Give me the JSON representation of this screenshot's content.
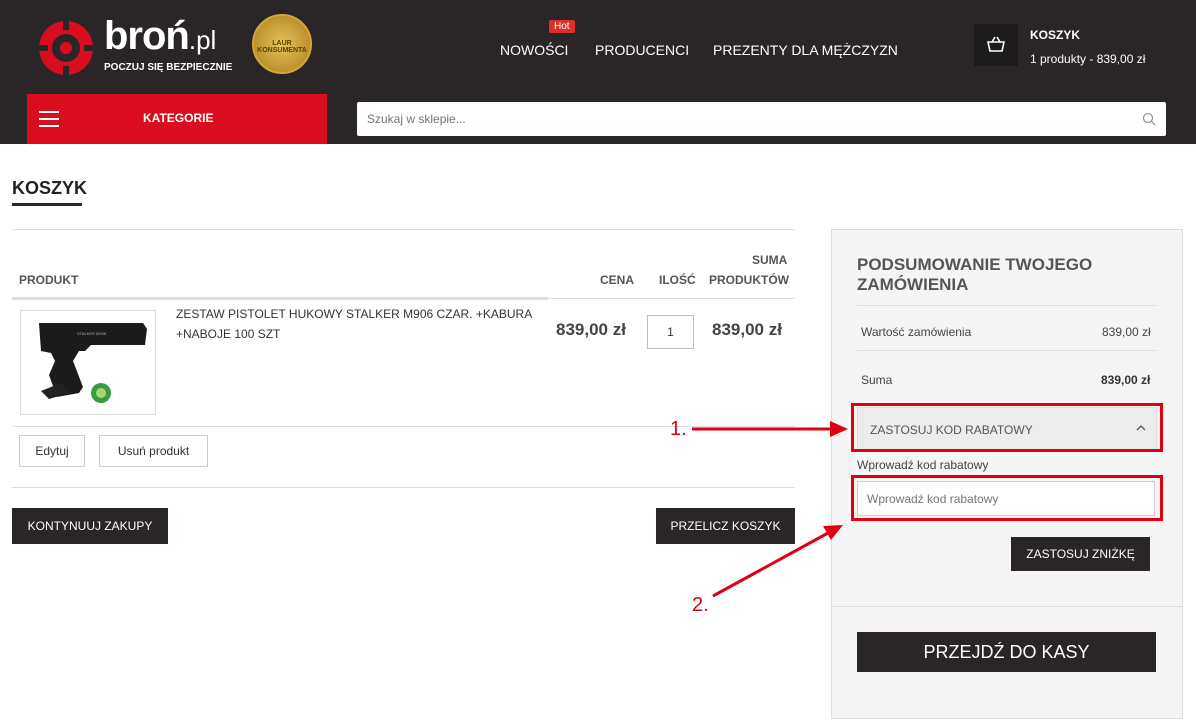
{
  "header": {
    "logo_main": "broń",
    "logo_suffix": ".pl",
    "logo_tagline": "POCZUJ SIĘ BEZPIECZNIE",
    "badge_text": "LAUR KONSUMENTA",
    "nav": [
      {
        "label": "NOWOŚCI",
        "badge": "Hot"
      },
      {
        "label": "PRODUCENCI"
      },
      {
        "label": "PREZENTY DLA MĘŻCZYZN"
      }
    ],
    "cart": {
      "title": "KOSZYK",
      "summary": "1 produkty - 839,00 zł"
    },
    "categories_label": "KATEGORIE",
    "search_placeholder": "Szukaj w sklepie..."
  },
  "page_title": "KOSZYK",
  "table": {
    "col_product": "PRODUKT",
    "col_price": "CENA",
    "col_qty": "ILOŚĆ",
    "col_sum_1": "SUMA",
    "col_sum_2": "PRODUKTÓW"
  },
  "item": {
    "name": "ZESTAW PISTOLET HUKOWY STALKER M906 CZAR. +KABURA +NABOJE 100 SZT",
    "image_caption": "STALKER M906",
    "price": "839,00 zł",
    "qty": "1",
    "subtotal": "839,00 zł",
    "edit_label": "Edytuj",
    "remove_label": "Usuń produkt"
  },
  "actions": {
    "continue_label": "KONTYNUUJ ZAKUPY",
    "recalc_label": "PRZELICZ KOSZYK"
  },
  "summary": {
    "title": "PODSUMOWANIE TWOJEGO ZAMÓWIENIA",
    "order_value_label": "Wartość zamówienia",
    "order_value": "839,00 zł",
    "total_label": "Suma",
    "total": "839,00 zł",
    "discount_toggle": "ZASTOSUJ KOD RABATOWY",
    "discount_field_label": "Wprowadź kod rabatowy",
    "discount_placeholder": "Wprowadź kod rabatowy",
    "apply_label": "ZASTOSUJ ZNIŻKĘ",
    "checkout_label": "PRZEJDŹ DO KASY"
  },
  "annotations": {
    "step1": "1.",
    "step2": "2."
  },
  "colors": {
    "brand_red": "#d90d1f",
    "dark": "#2a2627",
    "annotation_red": "#e00010"
  }
}
